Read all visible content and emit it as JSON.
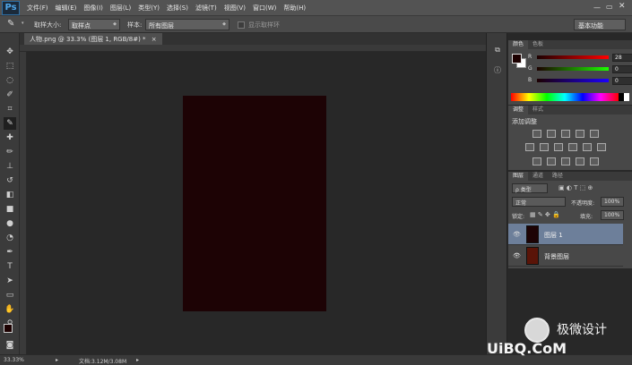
{
  "app": {
    "logo": "Ps"
  },
  "menu": [
    "文件(F)",
    "编辑(E)",
    "图像(I)",
    "图层(L)",
    "类型(Y)",
    "选择(S)",
    "滤镜(T)",
    "视图(V)",
    "窗口(W)",
    "帮助(H)"
  ],
  "options": {
    "sample_size_label": "取样大小:",
    "sample_size_value": "取样点",
    "sample_label": "样本:",
    "sample_value": "所有图层",
    "show_ring_label": "显示取样环",
    "workspace": "基本功能"
  },
  "document": {
    "tab_title": "人物.png @ 33.3% (图层 1, RGB/8#) *",
    "close_glyph": "×"
  },
  "status": {
    "zoom": "33.33%",
    "doc_info": "文档:3.12M/3.08M"
  },
  "color_panel": {
    "tabs": [
      "颜色",
      "色板"
    ],
    "r": 28,
    "g": 0,
    "b": 0,
    "foreground": "#1c0000",
    "r_label": "R",
    "g_label": "G",
    "b_label": "B"
  },
  "adjustments_panel": {
    "tabs": [
      "调整",
      "样式"
    ],
    "add_label": "添加调整"
  },
  "layers_panel": {
    "tabs": [
      "图层",
      "通道",
      "路径"
    ],
    "filter": "ρ 类型",
    "blend_mode": "正常",
    "opacity_label": "不透明度:",
    "opacity": "100%",
    "lock_label": "锁定:",
    "fill_label": "填充:",
    "fill": "100%",
    "layers": [
      {
        "name": "图层 1",
        "selected": true,
        "thumb": "#1d0305"
      },
      {
        "name": "背景图层",
        "selected": false,
        "thumb": "#5a1408"
      }
    ]
  },
  "watermark": {
    "brand": "极微设计",
    "site": "UiBQ.CoM"
  },
  "icons": [
    "eyedropper-icon",
    "move-icon",
    "marquee-icon",
    "lasso-icon",
    "quick-select-icon",
    "crop-icon",
    "brush-icon",
    "stamp-icon",
    "eraser-icon",
    "gradient-icon",
    "pen-icon",
    "type-icon",
    "hand-icon",
    "zoom-icon",
    "eye-icon"
  ]
}
